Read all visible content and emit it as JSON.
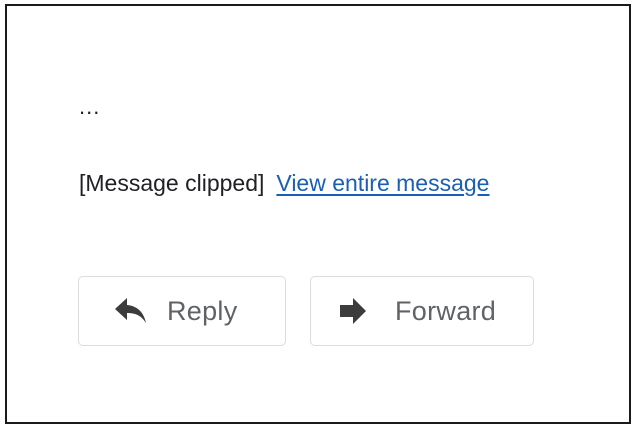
{
  "message": {
    "ellipsis": "...",
    "clipped_note": "[Message clipped]",
    "view_entire_link": "View entire message"
  },
  "actions": {
    "reply": {
      "label": "Reply",
      "icon": "reply-arrow-icon"
    },
    "forward": {
      "label": "Forward",
      "icon": "forward-arrow-icon"
    }
  },
  "colors": {
    "link": "#1a5fb4",
    "button_text": "#5f6368",
    "button_border": "#dadce0",
    "icon": "#3c3c3c",
    "frame_border": "#1a1a1a"
  }
}
